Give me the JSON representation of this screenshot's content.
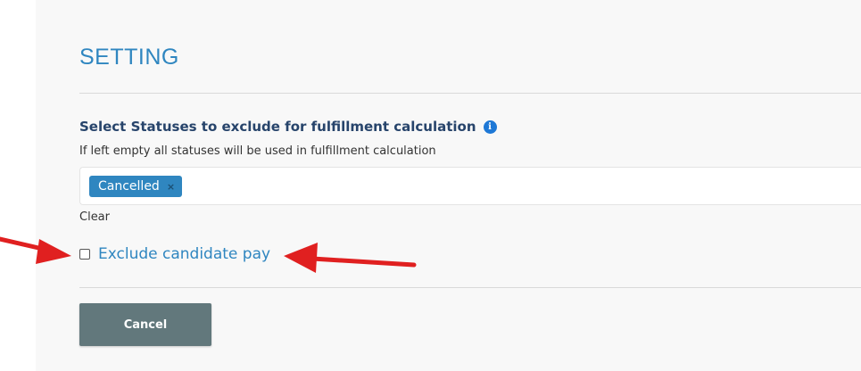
{
  "settings": {
    "title": "SETTING",
    "section_label": "Select Statuses to exclude for fulfillment calculation",
    "help_text": "If left empty all statuses will be used in fulfillment calculation",
    "selected_statuses": [
      "Cancelled"
    ],
    "tag_remove_glyph": "×",
    "clear_label": "Clear",
    "exclude_candidate_pay": {
      "label": "Exclude candidate pay",
      "checked": false
    },
    "cancel_label": "Cancel"
  },
  "icons": {
    "info": "info-icon",
    "tag_remove": "close-icon"
  },
  "colors": {
    "accent": "#2f86c0",
    "heading": "#27446b",
    "info_icon": "#1e78d6",
    "cancel_button": "#62787c",
    "annotation_arrow": "#e02020"
  }
}
